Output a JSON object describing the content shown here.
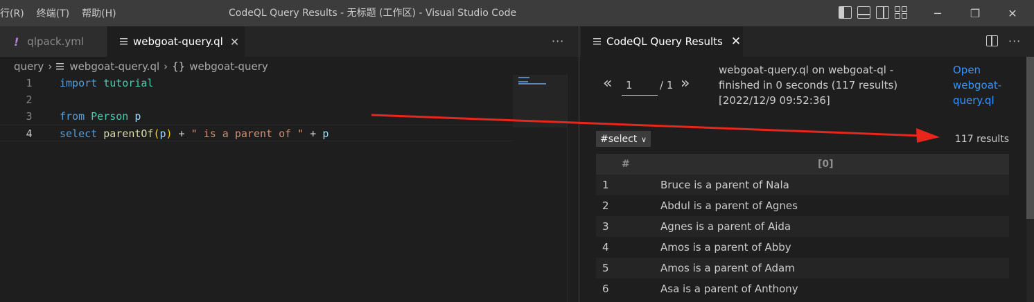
{
  "menu": [
    "行(R)",
    "终端(T)",
    "帮助(H)"
  ],
  "window_title": "CodeQL Query Results - 无标题 (工作区) - Visual Studio Code",
  "window_controls": {
    "minimize": "─",
    "restore": "❐",
    "close": "✕"
  },
  "editor": {
    "tabs": [
      {
        "label": "qlpack.yml",
        "icon": "exclamation-icon"
      },
      {
        "label": "webgoat-query.ql",
        "icon": "file-lines-icon",
        "close": "✕"
      }
    ],
    "more": "···",
    "breadcrumb": {
      "folder": "query",
      "file": "webgoat-query.ql",
      "symbol_icon": "{}",
      "symbol": "webgoat-query",
      "sep": "›"
    },
    "lines": [
      {
        "num": "1",
        "tokens": [
          [
            "kw",
            "import"
          ],
          [
            "op",
            " "
          ],
          [
            "ty",
            "tutorial"
          ]
        ]
      },
      {
        "num": "2",
        "tokens": []
      },
      {
        "num": "3",
        "tokens": [
          [
            "kw",
            "from"
          ],
          [
            "op",
            " "
          ],
          [
            "ty",
            "Person"
          ],
          [
            "op",
            " "
          ],
          [
            "var",
            "p"
          ]
        ]
      },
      {
        "num": "4",
        "tokens": [
          [
            "kw",
            "select"
          ],
          [
            "op",
            " "
          ],
          [
            "fn",
            "parentOf"
          ],
          [
            "paren",
            "("
          ],
          [
            "var",
            "p"
          ],
          [
            "paren",
            ")"
          ],
          [
            "op",
            " + "
          ],
          [
            "str",
            "\" is a parent of \""
          ],
          [
            "op",
            " + "
          ],
          [
            "var",
            "p"
          ]
        ]
      }
    ]
  },
  "results_panel": {
    "tab_label": "CodeQL Query Results",
    "tab_close": "✕",
    "more": "···",
    "pager": {
      "prev": "«",
      "page": "1",
      "total": "/ 1",
      "next": "»"
    },
    "info": "webgoat-query.ql on webgoat-ql - finished in 0 seconds (117 results) [2022/12/9 09:52:36]",
    "open_link": "Open webgoat-query.ql",
    "select": {
      "value": "#select",
      "chevron": "∨"
    },
    "count": "117 results",
    "columns": [
      "#",
      "[0]"
    ],
    "rows": [
      [
        "1",
        "Bruce is a parent of Nala"
      ],
      [
        "2",
        "Abdul is a parent of Agnes"
      ],
      [
        "3",
        "Agnes is a parent of Aida"
      ],
      [
        "4",
        "Amos is a parent of Abby"
      ],
      [
        "5",
        "Amos is a parent of Adam"
      ],
      [
        "6",
        "Asa is a parent of Anthony"
      ]
    ]
  },
  "colors": {
    "annotation_arrow": "#e8261b",
    "link": "#3794ff"
  }
}
